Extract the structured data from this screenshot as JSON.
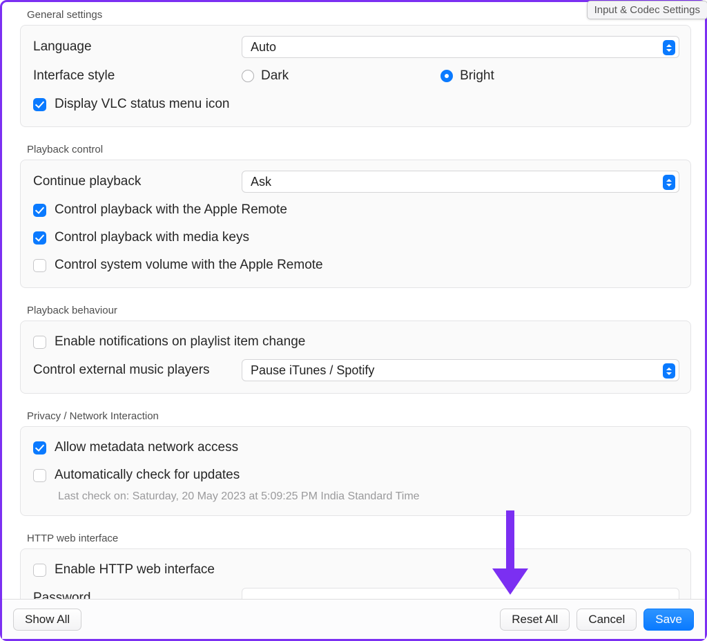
{
  "tooltip": "Input & Codec Settings",
  "sections": {
    "general": {
      "title": "General settings",
      "language_label": "Language",
      "language_value": "Auto",
      "interface_label": "Interface style",
      "interface_dark": "Dark",
      "interface_bright": "Bright",
      "status_menu": "Display VLC status menu icon"
    },
    "playback_control": {
      "title": "Playback control",
      "continue_label": "Continue playback",
      "continue_value": "Ask",
      "apple_remote_playback": "Control playback with the Apple Remote",
      "media_keys": "Control playback with media keys",
      "apple_remote_volume": "Control system volume with the Apple Remote"
    },
    "playback_behaviour": {
      "title": "Playback behaviour",
      "notifications": "Enable notifications on playlist item change",
      "external_players_label": "Control external music players",
      "external_players_value": "Pause iTunes / Spotify"
    },
    "privacy": {
      "title": "Privacy / Network Interaction",
      "metadata": "Allow metadata network access",
      "updates": "Automatically check for updates",
      "last_check": "Last check on: Saturday, 20 May 2023 at 5:09:25 PM India Standard Time"
    },
    "http": {
      "title": "HTTP web interface",
      "enable": "Enable HTTP web interface",
      "password_label": "Password"
    }
  },
  "footer": {
    "show_all": "Show All",
    "reset_all": "Reset All",
    "cancel": "Cancel",
    "save": "Save"
  },
  "state": {
    "interface_style": "Bright",
    "status_menu_checked": true,
    "apple_remote_playback_checked": true,
    "media_keys_checked": true,
    "apple_remote_volume_checked": false,
    "notifications_checked": false,
    "metadata_checked": true,
    "updates_checked": false,
    "http_enabled": false
  }
}
